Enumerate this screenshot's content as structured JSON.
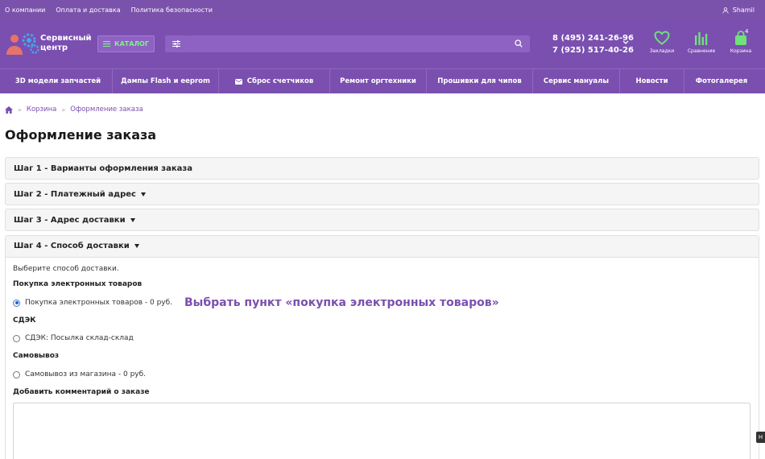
{
  "topbar": {
    "links": [
      "О компании",
      "Оплата и доставка",
      "Политика безопасности"
    ],
    "user": "Shamil"
  },
  "header": {
    "logo_line1": "Сервисный",
    "logo_line2": "центр",
    "catalog_label": "КАТАЛОГ",
    "search_placeholder": "",
    "phone1": "8 (495) 241-26-96",
    "phone2": "7 (925) 517-40-26",
    "wishlist_label": "Закладки",
    "compare_label": "Сравнение",
    "cart_label": "Корзина",
    "cart_count": "4"
  },
  "nav": {
    "items": [
      "3D модели запчастей",
      "Дампы Flash и eeprom",
      "Сброс счетчиков",
      "Ремонт оргтехники",
      "Прошивки для чипов",
      "Сервис мануалы",
      "Новости",
      "Фотогалерея"
    ]
  },
  "breadcrumb": {
    "cart": "Корзина",
    "current": "Оформление заказа"
  },
  "page": {
    "title": "Оформление заказа"
  },
  "steps": {
    "s1": "Шаг 1 - Варианты оформления заказа",
    "s2": "Шаг 2 - Платежный адрес",
    "s3": "Шаг 3 - Адрес доставки",
    "s4": "Шаг 4 - Способ доставки"
  },
  "shipping": {
    "intro": "Выберите способ доставки.",
    "group1": "Покупка электронных товаров",
    "opt1": "Покупка электронных товаров - 0 руб.",
    "group2": "СДЭК",
    "opt2": "СДЭК: Посылка склад-склад",
    "group3": "Самовывоз",
    "opt3": "Самовывоз из магазина - 0 руб.",
    "comment_label": "Добавить комментарий о заказе",
    "comment_value": ""
  },
  "annotation": "Выбрать пункт «покупка электронных товаров»",
  "side_tab": "Н",
  "colors": {
    "primary": "#7a4fb0",
    "accent_green": "#6fe07a"
  }
}
